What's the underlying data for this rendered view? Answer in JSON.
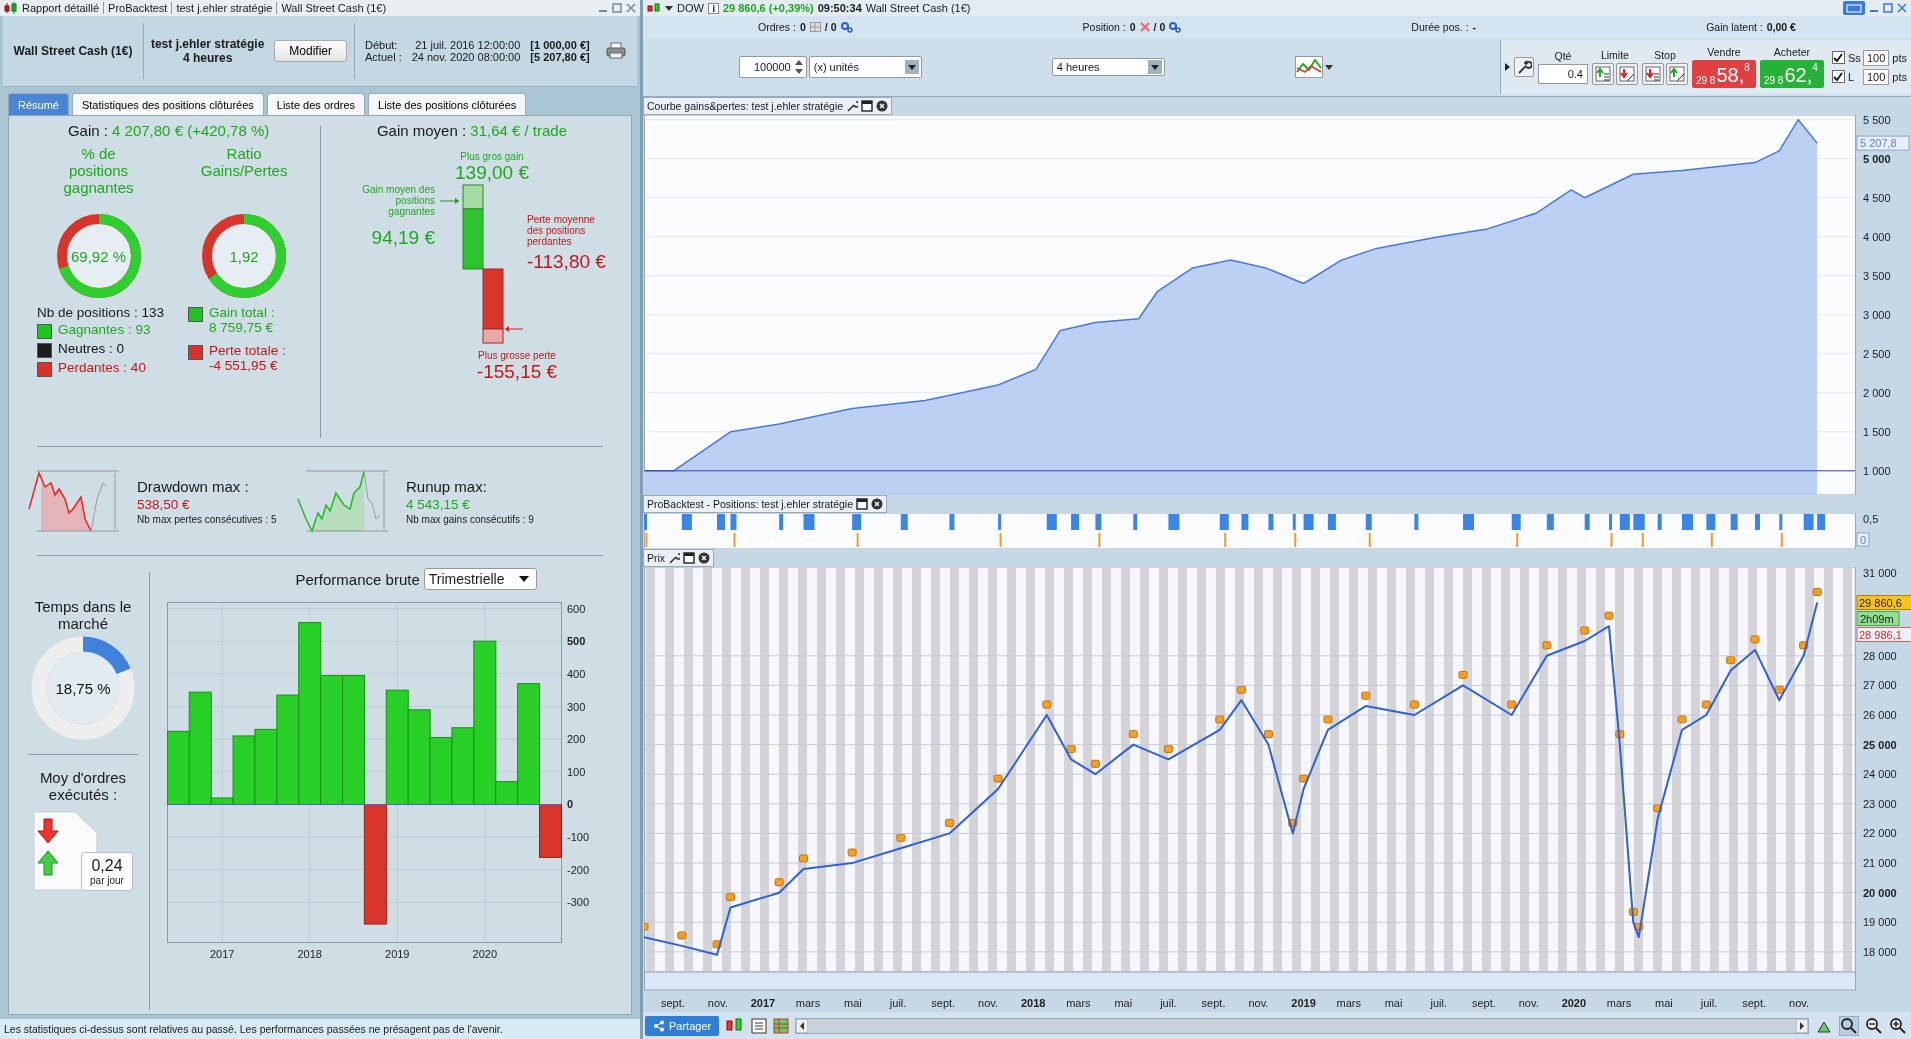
{
  "left_window": {
    "title_segments": [
      "Rapport détaillé",
      "ProBacktest",
      "test j.ehler stratégie",
      "Wall Street Cash (1€)"
    ],
    "header": {
      "instrument": "Wall Street Cash (1€)",
      "strategy": "test j.ehler stratégie",
      "timeframe": "4 heures",
      "modify_button": "Modifier",
      "start_label": "Début:",
      "start_date": "21 juil. 2016 12:00:00",
      "start_value": "[1 000,00 €]",
      "current_label": "Actuel :",
      "current_date": "24 nov. 2020 08:00:00",
      "current_value": "[5 207,80 €]"
    },
    "tabs": [
      {
        "label": "Résumé",
        "selected": true
      },
      {
        "label": "Statistiques des positions clôturées",
        "selected": false
      },
      {
        "label": "Liste des ordres",
        "selected": false
      },
      {
        "label": "Liste des positions clôturées",
        "selected": false
      }
    ],
    "summary": {
      "gain_label": "Gain :",
      "gain_value": "4 207,80 € (+420,78 %)",
      "win_rate": {
        "title": "% de positions gagnantes",
        "value": "69,92 %",
        "level": 0.6992
      },
      "ratio": {
        "title": "Ratio Gains/Pertes",
        "value": "1,92",
        "level": 0.658
      },
      "positions_count": "Nb de positions : 133",
      "legend": [
        {
          "kind": "win",
          "label": "Gagnantes : 93"
        },
        {
          "kind": "neutral",
          "label": "Neutres : 0"
        },
        {
          "kind": "loss",
          "label": "Perdantes : 40"
        }
      ],
      "totals": [
        {
          "kind": "win",
          "label": "Gain total :",
          "value": "8 759,75 €"
        },
        {
          "kind": "loss",
          "label": "Perte totale :",
          "value": "-4 551,95 €"
        }
      ],
      "avg_gain_label": "Gain moyen :",
      "avg_gain_value": "31,64 € / trade",
      "max_gain_label": "Plus gros gain",
      "max_gain_value": "139,00 €",
      "avg_win_label": "Gain moyen des positions gagnantes",
      "avg_win_value": "94,19 €",
      "avg_loss_label": "Perte moyenne des positions perdantes",
      "avg_loss_value": "-113,80 €",
      "max_loss_label": "Plus grosse perte",
      "max_loss_value": "-155,15 €",
      "drawdown": {
        "title": "Drawdown max :",
        "value": "538,50 €",
        "note": "Nb max pertes consécutives : 5"
      },
      "runup": {
        "title": "Runup max:",
        "value": "4 543,15 €",
        "note": "Nb max gains consécutifs : 9"
      },
      "time_in_market": {
        "title": "Temps dans le marché",
        "value": "18,75 %",
        "level": 0.1875
      },
      "orders": {
        "title": "Moy d'ordres exécutés :",
        "value": "0,24",
        "unit": "par jour"
      },
      "performance": {
        "title": "Performance brute",
        "period": "Trimestrielle",
        "chart_data": {
          "type": "bar",
          "x": [
            2016.5,
            2016.75,
            2017,
            2017.25,
            2017.5,
            2017.75,
            2018,
            2018.25,
            2018.5,
            2018.75,
            2019,
            2019.25,
            2019.5,
            2019.75,
            2020,
            2020.25,
            2020.5,
            2020.75
          ],
          "values": [
            224,
            344,
            20,
            210,
            230,
            335,
            557,
            395,
            395,
            -366,
            350,
            290,
            205,
            235,
            500,
            70,
            370,
            -162
          ],
          "xlim": [
            2016.37,
            2020.87
          ],
          "ylim": [
            -421,
            620
          ],
          "grid": true,
          "xticks": [
            2017,
            2018,
            2019,
            2020
          ],
          "yticks": [
            -300,
            -200,
            -100,
            0,
            100,
            200,
            300,
            400,
            500,
            600
          ]
        }
      }
    },
    "status_bar": "Les statistiques ci-dessus sont relatives au passé. Les performances passées ne présagent pas de l'avenir."
  },
  "right_window": {
    "title": {
      "symbol": "DOW",
      "quote": "29 860,6 (+0,39%)",
      "time": "09:50:34",
      "instrument": "Wall Street Cash (1€)"
    },
    "info_bar": [
      {
        "kind": "orders",
        "label": "Ordres :",
        "value": "0",
        "total": "/ 0"
      },
      {
        "kind": "position",
        "label": "Position :",
        "value": "0",
        "total": "/ 0"
      },
      {
        "kind": "plain",
        "label": "Durée pos. :",
        "value": "-"
      },
      {
        "kind": "plain",
        "label": "Gain latent :",
        "value": "0,00 €"
      }
    ],
    "toolbar": {
      "quantity": "100000",
      "unit": "(x) unités",
      "timeframe": "4 heures"
    },
    "order_panel": {
      "qty_label": "Qté",
      "qty": "0.4",
      "limit_label": "Limite",
      "stop_label": "Stop",
      "sell": {
        "label": "Vendre",
        "prefix": "29 8",
        "big": "58,",
        "sup": "8"
      },
      "buy": {
        "label": "Acheter",
        "prefix": "29 8",
        "big": "62,",
        "sup": "4"
      },
      "stops": [
        {
          "label": "Ss",
          "checked": true,
          "value": "100",
          "unit": "pts"
        },
        {
          "label": "L",
          "checked": true,
          "value": "100",
          "unit": "pts"
        }
      ]
    },
    "equity_panel": {
      "last_value": "5 207,8",
      "chart_data": {
        "type": "area",
        "x": [
          2016.56,
          2016.67,
          2016.88,
          2017.06,
          2017.33,
          2017.6,
          2017.87,
          2018.01,
          2018.1,
          2018.23,
          2018.39,
          2018.46,
          2018.59,
          2018.73,
          2018.86,
          2019.0,
          2019.14,
          2019.27,
          2019.5,
          2019.68,
          2019.86,
          2019.99,
          2020.04,
          2020.22,
          2020.4,
          2020.67,
          2020.76,
          2020.83,
          2020.9
        ],
        "series": [
          {
            "name": "Courbe gains&pertes: test j.ehler stratégie",
            "color": "#4a78d6",
            "values": [
              1000,
              1000,
              1500,
              1600,
              1800,
              1900,
              2100,
              2300,
              2800,
              2900,
              2950,
              3300,
              3600,
              3700,
              3600,
              3400,
              3700,
              3850,
              4000,
              4100,
              4300,
              4600,
              4500,
              4800,
              4850,
              4950,
              5100,
              5500,
              5200
            ]
          }
        ],
        "xlim": [
          2016.56,
          2021.04
        ],
        "ylim": [
          690,
          5560
        ],
        "grid": true,
        "yticks": [
          {
            "value": 1000,
            "label": "1 000"
          },
          {
            "value": 1500,
            "label": "1 500"
          },
          {
            "value": 2000,
            "label": "2 000"
          },
          {
            "value": 2500,
            "label": "2 500"
          },
          {
            "value": 3000,
            "label": "3 000"
          },
          {
            "value": 3500,
            "label": "3 500"
          },
          {
            "value": 4000,
            "label": "4 000"
          },
          {
            "value": 4500,
            "label": "4 500"
          },
          {
            "value": 5000,
            "label": "5 000"
          },
          {
            "value": 5500,
            "label": "5 500"
          }
        ]
      }
    },
    "positions_panel": {
      "title": "ProBacktest - Positions: test j.ehler stratégie",
      "scale_label": "0,5",
      "current_value": "0"
    },
    "price_panel": {
      "last_price": "29 860,6",
      "countdown": "2h09m",
      "low_price": "28 986,1",
      "chart_data": {
        "type": "line",
        "grid": true,
        "x": [
          2016.56,
          2016.7,
          2016.83,
          2016.88,
          2017.06,
          2017.15,
          2017.33,
          2017.51,
          2017.69,
          2017.87,
          2018.05,
          2018.14,
          2018.23,
          2018.37,
          2018.5,
          2018.69,
          2018.77,
          2018.87,
          2018.96,
          2019.0,
          2019.09,
          2019.23,
          2019.41,
          2019.59,
          2019.77,
          2019.9,
          2020.04,
          2020.13,
          2020.17,
          2020.22,
          2020.24,
          2020.31,
          2020.4,
          2020.49,
          2020.58,
          2020.67,
          2020.76,
          2020.85,
          2020.9
        ],
        "series": [
          {
            "name": "Prix",
            "color": "#2f62d0",
            "values": [
              18500,
              18200,
              17900,
              19500,
              20000,
              20800,
              21000,
              21500,
              22000,
              23500,
              26000,
              24500,
              24000,
              25000,
              24500,
              25500,
              26500,
              25000,
              22000,
              23500,
              25500,
              26300,
              26000,
              27000,
              26000,
              28000,
              28500,
              29000,
              25000,
              19000,
              18500,
              22500,
              25500,
              26000,
              27500,
              28200,
              26500,
              28000,
              29800
            ]
          }
        ],
        "xlim": [
          2016.56,
          2021.04
        ],
        "ylim": [
          17320,
          31000
        ],
        "xticks": [
          {
            "value": 2016.667,
            "label": "sept."
          },
          {
            "value": 2016.833,
            "label": "nov."
          },
          {
            "value": 2017,
            "label": "2017"
          },
          {
            "value": 2017.167,
            "label": "mars"
          },
          {
            "value": 2017.333,
            "label": "mai"
          },
          {
            "value": 2017.5,
            "label": "juil."
          },
          {
            "value": 2017.667,
            "label": "sept."
          },
          {
            "value": 2017.833,
            "label": "nov."
          },
          {
            "value": 2018,
            "label": "2018"
          },
          {
            "value": 2018.167,
            "label": "mars"
          },
          {
            "value": 2018.333,
            "label": "mai"
          },
          {
            "value": 2018.5,
            "label": "juil."
          },
          {
            "value": 2018.667,
            "label": "sept."
          },
          {
            "value": 2018.833,
            "label": "nov."
          },
          {
            "value": 2019,
            "label": "2019"
          },
          {
            "value": 2019.167,
            "label": "mars"
          },
          {
            "value": 2019.333,
            "label": "mai"
          },
          {
            "value": 2019.5,
            "label": "juil."
          },
          {
            "value": 2019.667,
            "label": "sept."
          },
          {
            "value": 2019.833,
            "label": "nov."
          },
          {
            "value": 2020,
            "label": "2020"
          },
          {
            "value": 2020.167,
            "label": "mars"
          },
          {
            "value": 2020.333,
            "label": "mai"
          },
          {
            "value": 2020.5,
            "label": "juil."
          },
          {
            "value": 2020.667,
            "label": "sept."
          },
          {
            "value": 2020.833,
            "label": "nov."
          }
        ],
        "yticks": [
          {
            "value": 18000,
            "label": "18 000"
          },
          {
            "value": 19000,
            "label": "19 000"
          },
          {
            "value": 20000,
            "label": "20 000"
          },
          {
            "value": 21000,
            "label": "21 000"
          },
          {
            "value": 22000,
            "label": "22 000"
          },
          {
            "value": 23000,
            "label": "23 000"
          },
          {
            "value": 24000,
            "label": "24 000"
          },
          {
            "value": 25000,
            "label": "25 000"
          },
          {
            "value": 26000,
            "label": "26 000"
          },
          {
            "value": 27000,
            "label": "27 000"
          },
          {
            "value": 28000,
            "label": "28 000"
          },
          {
            "value": 31000,
            "label": "31 000"
          }
        ]
      }
    },
    "bottom_bar": {
      "share_button": "Partager"
    }
  }
}
